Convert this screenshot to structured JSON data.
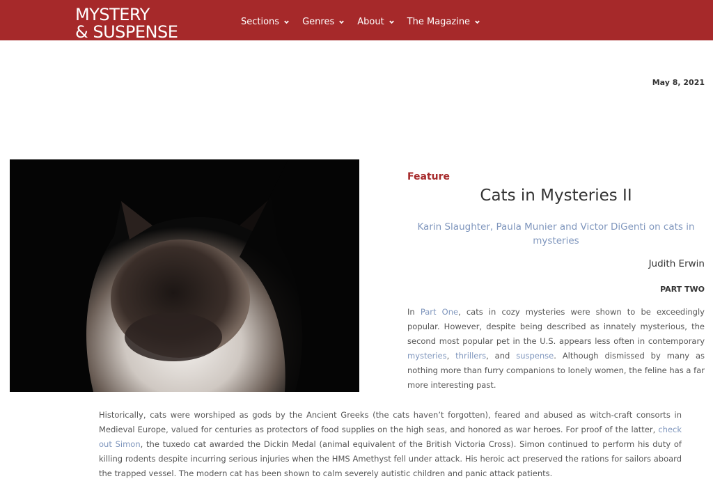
{
  "header": {
    "logo_line1": "MYSTERY",
    "logo_line2": "& SUSPENSE",
    "nav": [
      {
        "label": "Sections"
      },
      {
        "label": "Genres"
      },
      {
        "label": "About"
      },
      {
        "label": "The Magazine"
      }
    ],
    "colors": {
      "bar": "#a6292a",
      "text": "#ffffff"
    }
  },
  "article": {
    "date": "May 8, 2021",
    "category": "Feature",
    "title": "Cats in Mysteries II",
    "subtitle": "Karin Slaughter, Paula Munier and Victor DiGenti on cats in mysteries",
    "author": "Judith Erwin",
    "part": "PART TWO",
    "intro": {
      "t1": "In ",
      "link_part_one": "Part One",
      "t2": ", cats in cozy mysteries were shown to be exceedingly popular. However, despite being described as innately mysterious, the second most popular pet in the U.S. appears less often in contemporary ",
      "link_mysteries": "mysteries",
      "t3": ", ",
      "link_thrillers": "thrillers",
      "t4": ", and ",
      "link_suspense": "suspense",
      "t5": ". Although dismissed by many as nothing more than furry companions to lonely women, the feline has a far more interesting past."
    },
    "body": {
      "t1": "Historically, cats were worshiped as gods by the Ancient Greeks (the cats haven’t forgotten), feared and abused as witch-craft consorts in Medieval Europe, valued for centuries as protectors of food supplies on the high seas, and honored as war heroes. For proof of the latter, ",
      "link_simon": "check out Simon",
      "t2": ", the tuxedo cat awarded the Dickin Medal (animal equivalent of the British Victoria Cross). Simon continued to perform his duty of killing rodents despite incurring serious injuries when the HMS Amethyst fell under attack. His heroic act preserved the rations for sailors aboard the trapped vessel. The modern cat has been shown to calm severely autistic children and panic attack patients."
    },
    "colors": {
      "accent": "#a6292a",
      "link": "#7f96bd"
    }
  },
  "icons": {
    "nav_caret": "chevron-down-icon"
  }
}
